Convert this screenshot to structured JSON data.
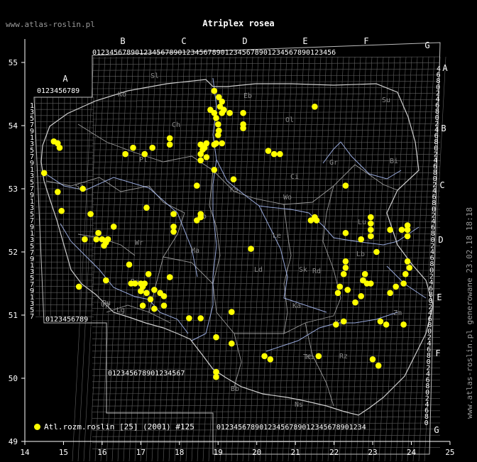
{
  "site_label": "www.atlas-roslin.pl",
  "title": "Atriplex rosea",
  "side_label": "www.atlas-roslin.pl generowane 23.02.18 18:18",
  "legend_label": "Atl.rozm.roslin [25] (2001) #125",
  "colors": {
    "background": "#000000",
    "points": "#ffff00",
    "grid": "#8a8a8a",
    "river": "#b0c4ff",
    "border": "#cfcfcf",
    "label": "#9a9a9a"
  },
  "axes": {
    "lon_ticks": [
      "14",
      "15",
      "16",
      "17",
      "18",
      "19",
      "20",
      "21",
      "22",
      "23",
      "24",
      "25"
    ],
    "lat_ticks": [
      "49",
      "50",
      "51",
      "52",
      "53",
      "54",
      "55"
    ]
  },
  "grid_columns": [
    "A",
    "B",
    "C",
    "D",
    "E",
    "F",
    "G"
  ],
  "grid_rows_right": [
    "A",
    "B",
    "C",
    "D",
    "E",
    "F",
    "G"
  ],
  "grid_digits": "0123456789",
  "region_codes": [
    "Sl",
    "Ko",
    "Eb",
    "Su",
    "Ol",
    "Ch",
    "Pl",
    "Bi",
    "Ci",
    "Gr",
    "Sz",
    "Po",
    "Ma",
    "Wr",
    "Lu",
    "Ks",
    "Wo",
    "Ra",
    "Le",
    "Sk",
    "Ld",
    "Pu",
    "Lg",
    "Ka",
    "Kr",
    "Ki",
    "Tr",
    "Op",
    "Zm",
    "Rz",
    "Ns",
    "Bb",
    "Rd",
    "Lb"
  ],
  "points": [
    [
      18.9,
      54.55
    ],
    [
      19.02,
      54.45
    ],
    [
      19.1,
      54.38
    ],
    [
      19.05,
      54.3
    ],
    [
      19.15,
      54.25
    ],
    [
      19.3,
      54.2
    ],
    [
      18.8,
      54.25
    ],
    [
      18.9,
      54.2
    ],
    [
      18.95,
      54.12
    ],
    [
      19.1,
      54.2
    ],
    [
      19.65,
      54.2
    ],
    [
      19.65,
      54.02
    ],
    [
      19.65,
      53.96
    ],
    [
      21.5,
      54.3
    ],
    [
      19.0,
      54.02
    ],
    [
      19.02,
      53.92
    ],
    [
      19.0,
      53.85
    ],
    [
      18.95,
      53.72
    ],
    [
      19.1,
      53.72
    ],
    [
      18.9,
      53.7
    ],
    [
      18.7,
      53.72
    ],
    [
      18.6,
      53.62
    ],
    [
      18.55,
      53.55
    ],
    [
      18.55,
      53.45
    ],
    [
      18.7,
      53.5
    ],
    [
      18.55,
      53.7
    ],
    [
      18.65,
      53.65
    ],
    [
      17.75,
      53.8
    ],
    [
      17.75,
      53.7
    ],
    [
      17.3,
      53.65
    ],
    [
      16.8,
      53.65
    ],
    [
      17.1,
      53.55
    ],
    [
      16.6,
      53.55
    ],
    [
      14.75,
      53.75
    ],
    [
      14.85,
      53.72
    ],
    [
      14.9,
      53.65
    ],
    [
      14.5,
      53.25
    ],
    [
      14.85,
      52.95
    ],
    [
      15.5,
      53.0
    ],
    [
      14.95,
      52.65
    ],
    [
      20.3,
      53.6
    ],
    [
      20.45,
      53.55
    ],
    [
      20.6,
      53.55
    ],
    [
      19.4,
      53.15
    ],
    [
      18.9,
      53.3
    ],
    [
      18.45,
      53.05
    ],
    [
      22.3,
      53.05
    ],
    [
      17.15,
      52.7
    ],
    [
      15.7,
      52.6
    ],
    [
      16.3,
      52.4
    ],
    [
      15.9,
      52.3
    ],
    [
      16.0,
      52.2
    ],
    [
      16.1,
      52.15
    ],
    [
      15.85,
      52.2
    ],
    [
      15.55,
      52.2
    ],
    [
      16.05,
      52.1
    ],
    [
      16.15,
      52.2
    ],
    [
      18.55,
      52.6
    ],
    [
      18.55,
      52.55
    ],
    [
      18.45,
      52.5
    ],
    [
      17.85,
      52.6
    ],
    [
      17.85,
      52.4
    ],
    [
      17.85,
      52.32
    ],
    [
      19.85,
      52.05
    ],
    [
      21.5,
      52.55
    ],
    [
      21.4,
      52.5
    ],
    [
      21.55,
      52.5
    ],
    [
      22.3,
      52.3
    ],
    [
      22.95,
      52.55
    ],
    [
      22.95,
      52.45
    ],
    [
      22.95,
      52.35
    ],
    [
      22.95,
      52.25
    ],
    [
      22.7,
      52.2
    ],
    [
      23.45,
      52.35
    ],
    [
      23.75,
      52.35
    ],
    [
      23.9,
      52.35
    ],
    [
      23.9,
      52.25
    ],
    [
      23.9,
      52.42
    ],
    [
      23.1,
      52.0
    ],
    [
      16.1,
      51.55
    ],
    [
      15.4,
      51.45
    ],
    [
      16.7,
      51.8
    ],
    [
      16.75,
      51.5
    ],
    [
      16.85,
      51.5
    ],
    [
      17.0,
      51.5
    ],
    [
      17.05,
      51.45
    ],
    [
      17.0,
      51.38
    ],
    [
      17.15,
      51.35
    ],
    [
      17.1,
      51.5
    ],
    [
      17.2,
      51.65
    ],
    [
      17.35,
      51.4
    ],
    [
      17.5,
      51.35
    ],
    [
      17.6,
      51.3
    ],
    [
      17.25,
      51.25
    ],
    [
      17.35,
      51.1
    ],
    [
      17.05,
      51.15
    ],
    [
      17.6,
      51.15
    ],
    [
      17.75,
      51.6
    ],
    [
      18.25,
      50.95
    ],
    [
      18.55,
      50.95
    ],
    [
      19.35,
      51.05
    ],
    [
      22.3,
      51.85
    ],
    [
      22.3,
      51.75
    ],
    [
      22.25,
      51.65
    ],
    [
      22.15,
      51.45
    ],
    [
      22.1,
      51.35
    ],
    [
      22.35,
      51.4
    ],
    [
      22.55,
      51.2
    ],
    [
      22.8,
      51.65
    ],
    [
      22.75,
      51.55
    ],
    [
      22.85,
      51.5
    ],
    [
      22.95,
      51.5
    ],
    [
      22.7,
      51.3
    ],
    [
      23.45,
      51.35
    ],
    [
      23.6,
      51.45
    ],
    [
      23.95,
      51.75
    ],
    [
      23.9,
      51.85
    ],
    [
      23.85,
      51.65
    ],
    [
      23.8,
      51.5
    ],
    [
      23.2,
      50.9
    ],
    [
      23.35,
      50.85
    ],
    [
      23.8,
      50.85
    ],
    [
      22.25,
      50.9
    ],
    [
      22.05,
      50.85
    ],
    [
      21.6,
      50.35
    ],
    [
      18.95,
      50.65
    ],
    [
      19.35,
      50.55
    ],
    [
      20.2,
      50.35
    ],
    [
      20.35,
      50.3
    ],
    [
      23.0,
      50.3
    ],
    [
      23.15,
      50.2
    ],
    [
      18.95,
      50.1
    ],
    [
      18.95,
      50.02
    ]
  ]
}
